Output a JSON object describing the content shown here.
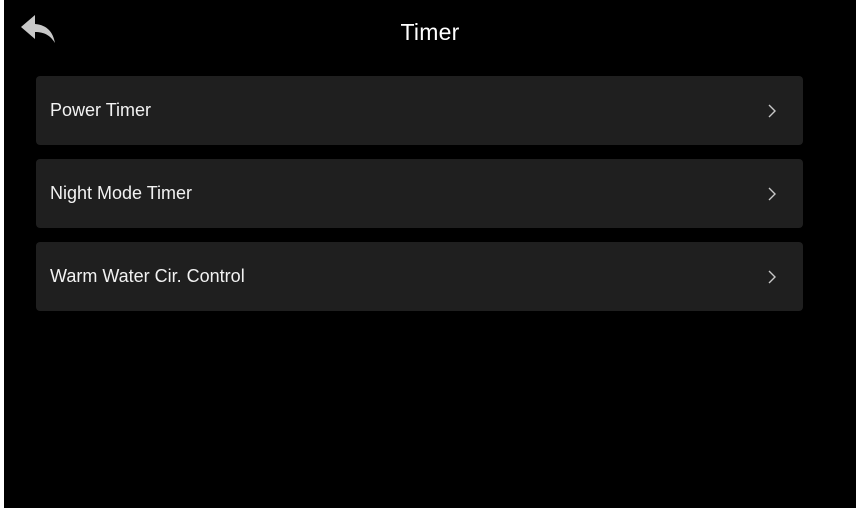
{
  "header": {
    "title": "Timer",
    "back_icon": "back-arrow-icon"
  },
  "menu": {
    "items": [
      {
        "label": "Power Timer",
        "icon": "chevron-right-icon"
      },
      {
        "label": "Night Mode Timer",
        "icon": "chevron-right-icon"
      },
      {
        "label": "Warm Water Cir. Control",
        "icon": "chevron-right-icon"
      }
    ]
  },
  "colors": {
    "background": "#000000",
    "item_background": "#1f1f1f",
    "text": "#ffffff",
    "icon": "#c8c8c8"
  }
}
